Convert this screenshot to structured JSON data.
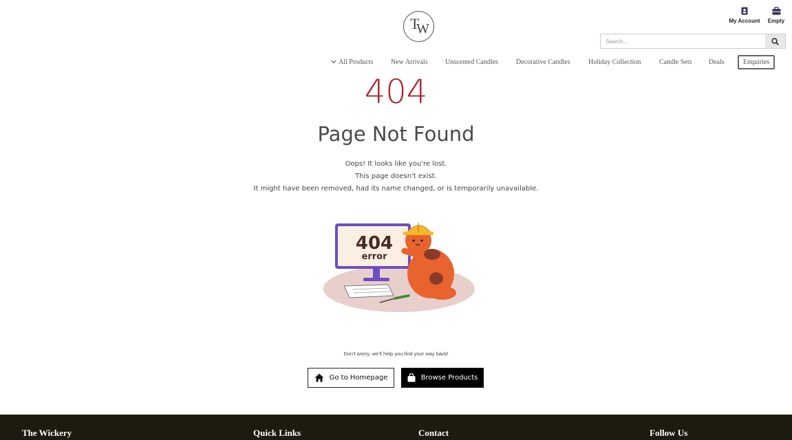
{
  "header": {
    "logo_letters": [
      "T",
      "W"
    ],
    "account_label": "My Account",
    "cart_label": "Empty",
    "search_placeholder": "Search..."
  },
  "nav": {
    "items": [
      "All Products",
      "New Arrivals",
      "Unscented Candles",
      "Decorative Candles",
      "Holiday Collection",
      "Candle Sets",
      "Deals",
      "Enquiries"
    ]
  },
  "error": {
    "code": "404",
    "title": "Page Not Found",
    "lines": [
      "Oops! It looks like you're lost.",
      "This page doesn't exist.",
      "It might have been removed, had its name changed, or is temporarily unavailable."
    ],
    "illustration_text": [
      "404",
      "error"
    ],
    "reassurance": "Don't worry, we'll help you find your way back!"
  },
  "buttons": {
    "home": "Go to Homepage",
    "browse": "Browse Products"
  },
  "footer": {
    "headings": [
      "The Wickery",
      "Quick Links",
      "Contact",
      "Follow Us"
    ]
  },
  "colors": {
    "accent_red": "#a8242f",
    "footer_bg": "#1d1a0f"
  }
}
